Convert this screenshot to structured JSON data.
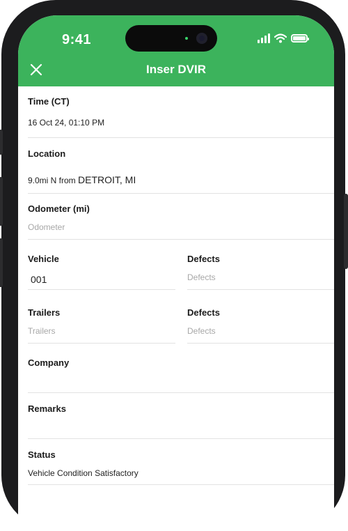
{
  "status_bar": {
    "time": "9:41"
  },
  "header": {
    "title": "Inser DVIR",
    "close_icon": "close-icon"
  },
  "form": {
    "time": {
      "label": "Time (CT)",
      "value": "16 Oct 24, 01:10 PM"
    },
    "location": {
      "label": "Location",
      "prefix": "9.0mi N from ",
      "city": "DETROIT, MI"
    },
    "odometer": {
      "label": "Odometer (mi)",
      "placeholder": "Odometer"
    },
    "vehicle": {
      "label": "Vehicle",
      "value": "001"
    },
    "vehicle_defects": {
      "label": "Defects",
      "placeholder": "Defects"
    },
    "trailers": {
      "label": "Trailers",
      "placeholder": "Trailers"
    },
    "trailer_defects": {
      "label": "Defects",
      "placeholder": "Defects"
    },
    "company": {
      "label": "Company",
      "value": ""
    },
    "remarks": {
      "label": "Remarks",
      "value": ""
    },
    "status": {
      "label": "Status",
      "value": "Vehicle Condition Satisfactory"
    }
  },
  "colors": {
    "header": "#3cb35c",
    "frame": "#1c1c1e"
  }
}
